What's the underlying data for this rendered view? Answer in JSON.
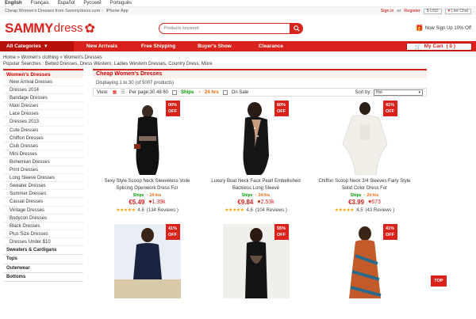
{
  "top": {
    "languages": [
      "English",
      "Français",
      "Español",
      "Русский",
      "Português"
    ],
    "tagline": "Cheap Women's Dresses from Sammydress.com",
    "iphone_app": "iPhone App",
    "sign_in": "Sign in",
    "or": "or",
    "register": "Register",
    "currency": "$ USD",
    "live_chat": "Live Chat"
  },
  "header": {
    "logo_sammy": "SAMMY",
    "logo_dress": "dress",
    "search_placeholder": "Products keyword",
    "promo": "Now Sign Up 10% Off"
  },
  "nav": {
    "all_categories": "All Categories",
    "items": [
      "New Arrivals",
      "Free Shipping",
      "Buyer's Show",
      "Clearance"
    ],
    "cart_label": "My Cart",
    "cart_count": "( 0 )"
  },
  "breadcrumb": "Home » Women's clothing » Women's Dresses",
  "popular": "Popular Searches : Belted Dresses, Dress Western, Ladies Western Dresses, Country Dress, More",
  "sidebar": {
    "header": "Women's Dresses",
    "items": [
      "New Arrival Dresses",
      "Dresses 2014",
      "Bandage Dresses",
      "Maxi Dresses",
      "Lace Dresses",
      "Dresses 2013",
      "Cute Dresses",
      "Chiffon Dresses",
      "Club Dresses",
      "Mini Dresses",
      "Bohemian Dresses",
      "Print Dresses",
      "Long Sleeve Dresses",
      "Sweater Dresses",
      "Summer Dresses",
      "Casual Dresses",
      "Vintage Dresses",
      "Bodycon Dresses",
      "Black Dresses",
      "Plus Size Dresses",
      "Dresses Under $10"
    ],
    "categories": [
      "Sweaters & Cardigans",
      "Tops",
      "Outerwear",
      "Bottoms"
    ]
  },
  "content": {
    "title": "Cheap Women's Dresses",
    "count": "Displaying 1 to 30 (of 5007 products)",
    "view_label": "View:",
    "per_page": "Per page:30  48  60",
    "ships_label": "Ships",
    "hrs_label": "24 hrs",
    "on_sale": "On Sale",
    "sort_label": "Sort by:",
    "sort_value": "Hot"
  },
  "products": [
    {
      "badge_pct": "00%",
      "badge_off": "OFF",
      "name": "Sexy Style Scoop Neck Sleeveless Voile Splicing Openwork Dress For",
      "price": "€5.49",
      "likes": "1.39k",
      "rating": "4.6",
      "reviews": "(134 Reviews )",
      "ships": "Ships",
      "hrs": "24 hrs"
    },
    {
      "badge_pct": "60%",
      "badge_off": "OFF",
      "name": "Luxury Boat Neck Faux Pearl Embellished Backless Long Sleeve",
      "price": "€9.84",
      "likes": "2.53k",
      "rating": "4.6",
      "reviews": "(104 Reviews )",
      "ships": "Ships",
      "hrs": "24 hrs"
    },
    {
      "badge_pct": "41%",
      "badge_off": "OFF",
      "name": "Chiffon Scoop Neck 3/4 Sleeves Fairy Style Solid Color Dress For",
      "price": "€3.99",
      "likes": "673",
      "rating": "4.5",
      "reviews": "(43 Reviews )",
      "ships": "Ships",
      "hrs": "24 hrs"
    }
  ],
  "products_row2": [
    {
      "badge_pct": "41%",
      "badge_off": "OFF"
    },
    {
      "badge_pct": "55%",
      "badge_off": "OFF"
    },
    {
      "badge_pct": "41%",
      "badge_off": "OFF"
    }
  ],
  "back_to_top": "TOP"
}
